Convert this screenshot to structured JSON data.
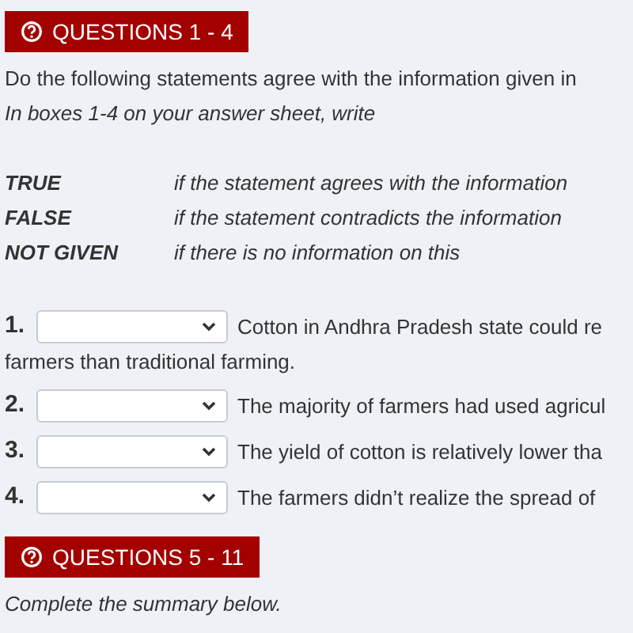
{
  "sections": [
    {
      "heading": "QUESTIONS 1 - 4",
      "instruction": "Do the following statements agree with the information given in",
      "subinstruction": "In boxes 1-4 on your answer sheet, write",
      "legend": [
        {
          "term": "TRUE",
          "meaning": "if the statement agrees with the information"
        },
        {
          "term": "FALSE",
          "meaning": "if the statement contradicts the information"
        },
        {
          "term": "NOT GIVEN",
          "meaning": "if there is no information on this"
        }
      ],
      "questions": [
        {
          "number": "1.",
          "text": "Cotton in Andhra Pradesh state could re",
          "continuation": "farmers than traditional farming."
        },
        {
          "number": "2.",
          "text": "The majority of farmers had used agricul"
        },
        {
          "number": "3.",
          "text": "The yield of cotton is relatively lower tha"
        },
        {
          "number": "4.",
          "text": "The farmers didn’t realize the spread of"
        }
      ]
    },
    {
      "heading": "QUESTIONS 5 - 11",
      "subinstruction": "Complete the summary below."
    }
  ]
}
